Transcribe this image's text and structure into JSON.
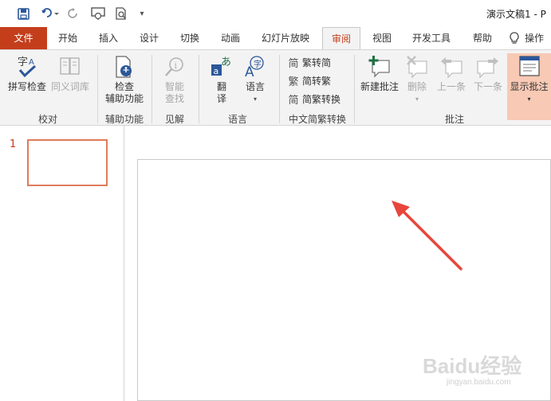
{
  "titlebar": {
    "doc_title": "演示文稿1 - P"
  },
  "tabs": {
    "file": "文件",
    "home": "开始",
    "insert": "插入",
    "design": "设计",
    "transitions": "切换",
    "animations": "动画",
    "slideshow": "幻灯片放映",
    "review": "审阅",
    "view": "视图",
    "developer": "开发工具",
    "help": "帮助",
    "tell_me": "操作"
  },
  "ribbon": {
    "proofing": {
      "spelling": "拼写检查",
      "thesaurus": "同义词库",
      "label": "校对"
    },
    "accessibility": {
      "check_line1": "检查",
      "check_line2": "辅助功能",
      "label": "辅助功能"
    },
    "insights": {
      "smart_line1": "智能",
      "smart_line2": "查找",
      "label": "见解"
    },
    "language": {
      "translate_line1": "翻",
      "translate_line2": "译",
      "language_btn": "语言",
      "label": "语言"
    },
    "chinese_conversion": {
      "to_simplified": "繁转简",
      "to_traditional": "简转繁",
      "convert": "简繁转换",
      "label": "中文简繁转换"
    },
    "comments": {
      "new": "新建批注",
      "delete": "删除",
      "previous": "上一条",
      "next": "下一条",
      "show": "显示批注",
      "label": "批注"
    }
  },
  "slides": {
    "number": "1"
  },
  "watermark": {
    "text": "Baidu经验",
    "url": "jingyan.baidu.com"
  }
}
